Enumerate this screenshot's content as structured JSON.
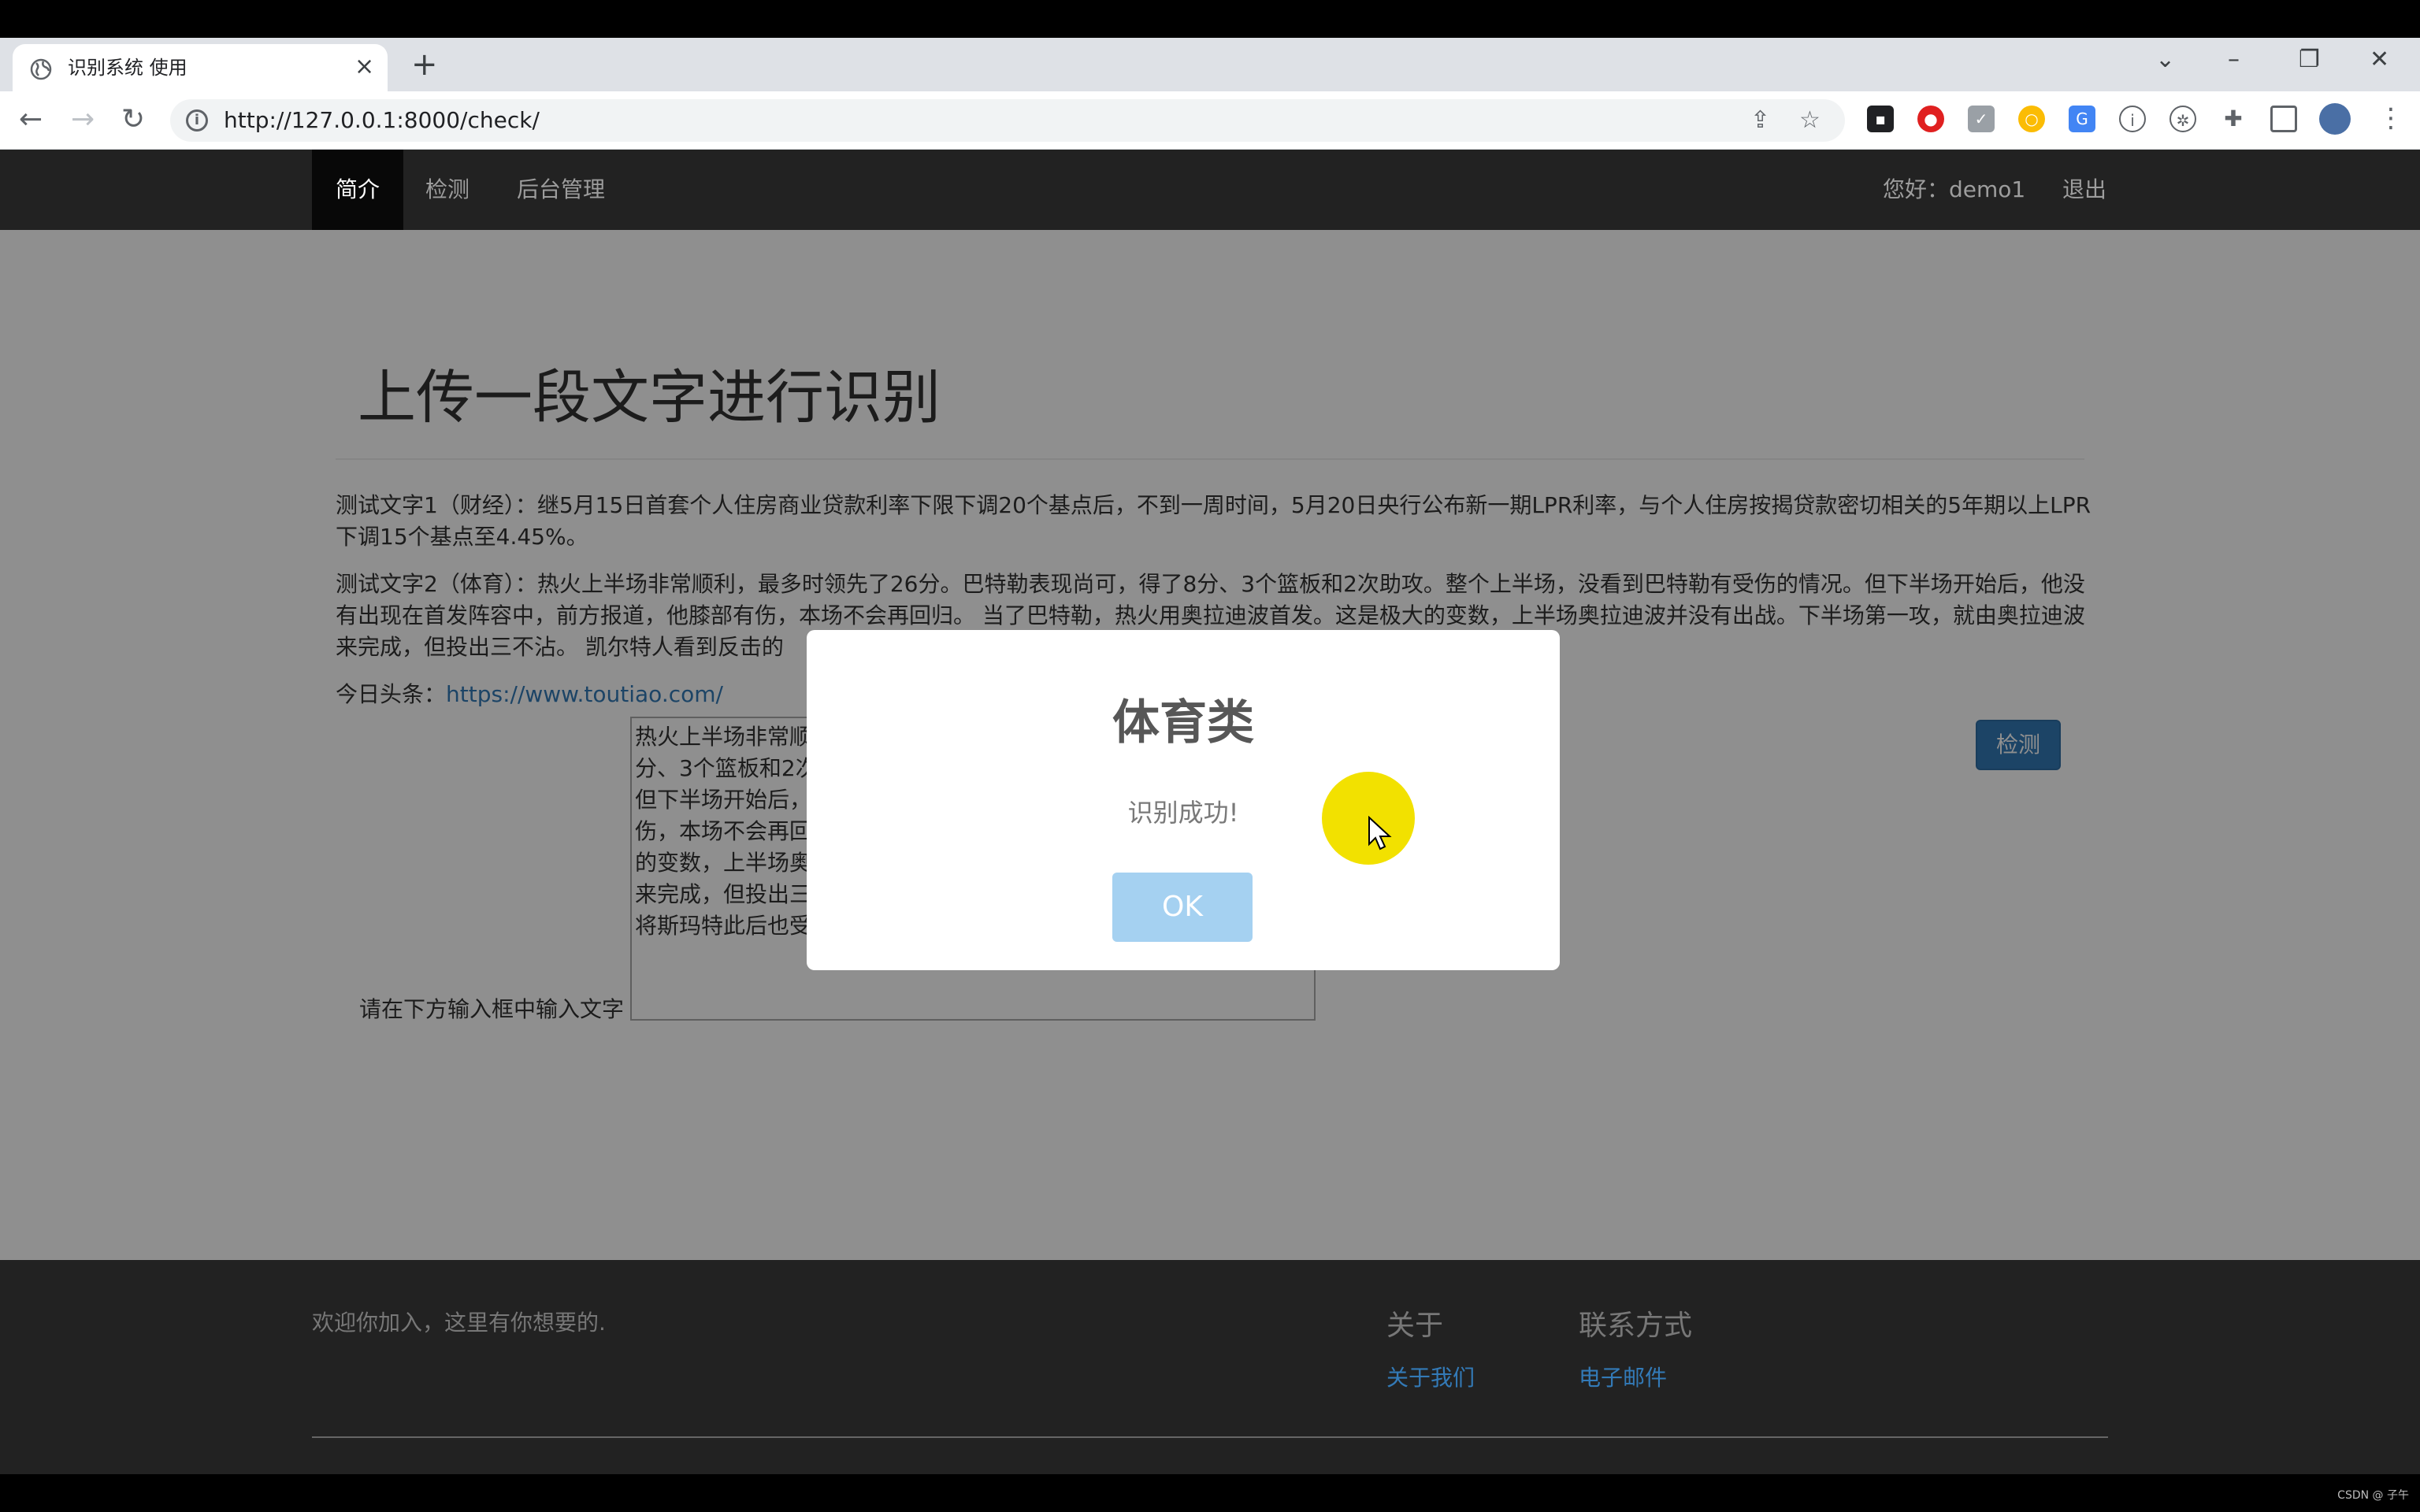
{
  "browser": {
    "tab_title": "识别系统 使用",
    "url": "http://127.0.0.1:8000/check/",
    "icons": [
      "globe-icon",
      "close-icon",
      "plus-icon",
      "back-icon",
      "forward-icon",
      "reload-icon",
      "info-icon",
      "share-icon",
      "star-icon",
      "extension-icon",
      "sidebar-icon",
      "avatar",
      "menu-icon"
    ]
  },
  "navbar": {
    "items": [
      "简介",
      "检测",
      "后台管理"
    ],
    "greeting": "您好：demo1",
    "logout": "退出"
  },
  "main": {
    "heading": "上传一段文字进行识别",
    "sample1": "测试文字1（财经）：继5月15日首套个人住房商业贷款利率下限下调20个基点后，不到一周时间，5月20日央行公布新一期LPR利率，与个人住房按揭贷款密切相关的5年期以上LPR下调15个基点至4.45%。",
    "sample2": "测试文字2（体育）：热火上半场非常顺利，最多时领先了26分。巴特勒表现尚可，得了8分、3个篮板和2次助攻。整个上半场，没看到巴特勒有受伤的情况。但下半场开始后，他没有出现在首发阵容中，前方报道，他膝部有伤，本场不会再回归。 当了巴特勒，热火用奥拉迪波首发。这是极大的变数，上半场奥拉迪波并没有出战。下半场第一攻，就由奥拉迪波来完成，但投出三不沾。 凯尔特人看到反击的",
    "toutiao_label": "今日头条：",
    "toutiao_link": "https://www.toutiao.com/",
    "textarea_lines": [
      "热火上半场非常顺",
      "分、3个篮板和2次",
      "但下半场开始后，",
      "伤，本场不会再回",
      "的变数，上半场奥",
      "来完成，但投出三",
      "将斯玛特此后也受"
    ],
    "input_label": "请在下方输入框中输入文字",
    "detect_button": "检测"
  },
  "footer": {
    "welcome": "欢迎你加入，这里有你想要的.",
    "about_title": "关于",
    "about_link": "关于我们",
    "contact_title": "联系方式",
    "contact_link": "电子邮件"
  },
  "dialog": {
    "title": "体育类",
    "message": "识别成功!",
    "ok": "OK"
  },
  "watermark": "CSDN @ 子午"
}
